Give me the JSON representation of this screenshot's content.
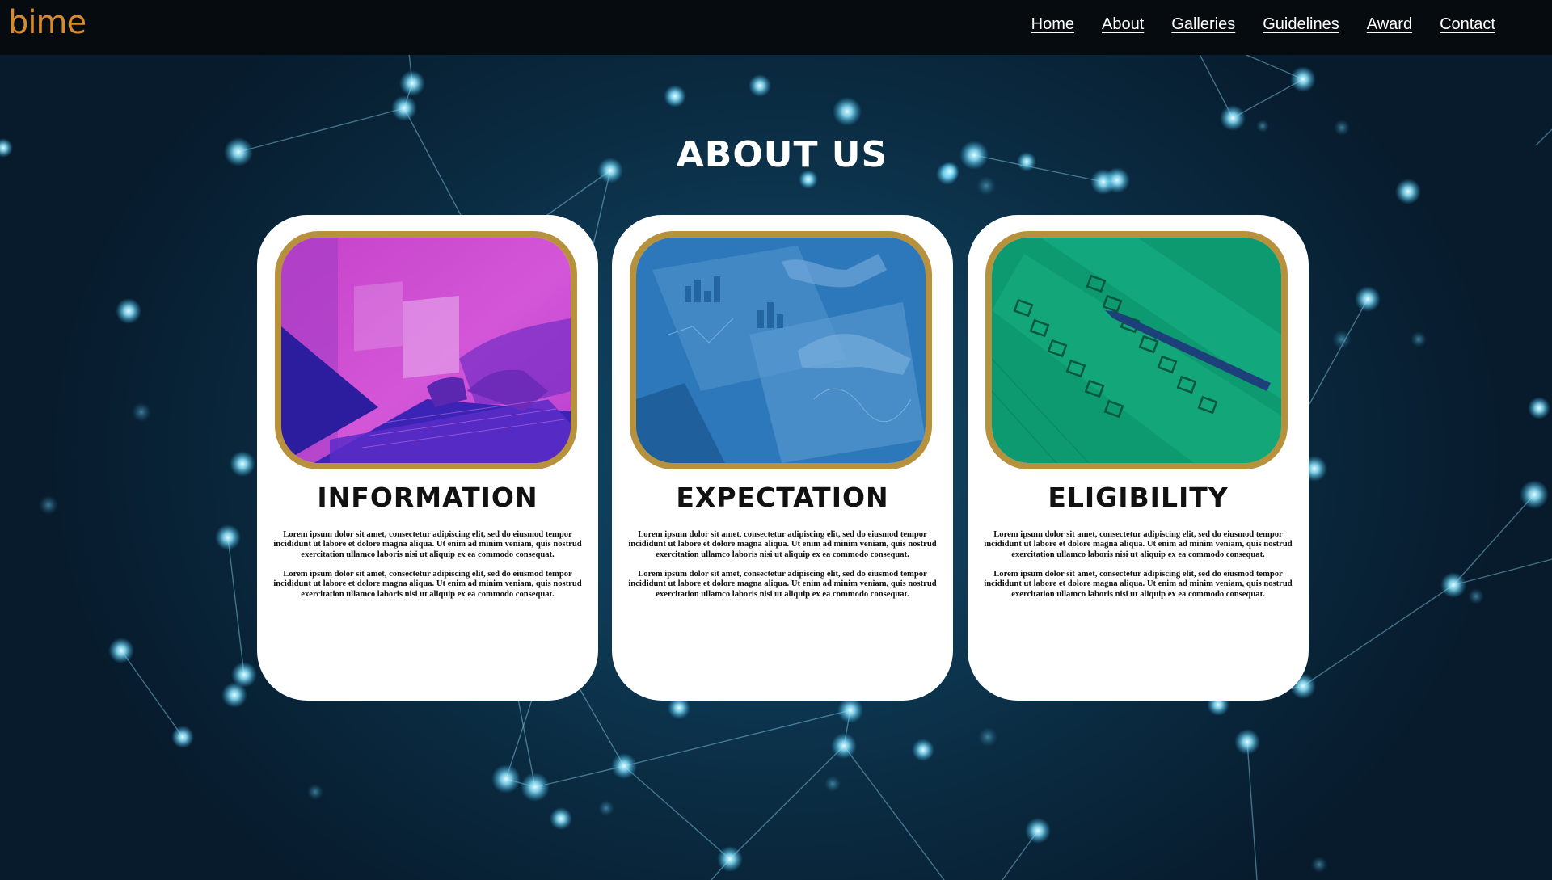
{
  "brand": {
    "logo_text": "bime",
    "logo_color": "#d68a2f"
  },
  "nav": {
    "items": [
      {
        "label": "Home"
      },
      {
        "label": "About"
      },
      {
        "label": "Galleries"
      },
      {
        "label": "Guidelines"
      },
      {
        "label": "Award"
      },
      {
        "label": "Contact"
      }
    ]
  },
  "main": {
    "heading": "ABOUT US",
    "cards": [
      {
        "title": "INFORMATION",
        "image_icon": "laptop-typing-photo",
        "image_tint": "#c43fd6",
        "paragraphs": [
          "Lorem ipsum dolor sit amet, consectetur adipiscing elit, sed do eiusmod tempor incididunt ut labore et dolore magna aliqua. Ut enim ad minim veniam, quis nostrud exercitation ullamco laboris nisi ut aliquip ex ea commodo consequat.",
          "Lorem ipsum dolor sit amet, consectetur adipiscing elit, sed do eiusmod tempor incididunt ut labore et dolore magna aliqua. Ut enim ad minim veniam, quis nostrud exercitation ullamco laboris nisi ut aliquip ex ea commodo consequat."
        ]
      },
      {
        "title": "EXPECTATION",
        "image_icon": "documents-charts-photo",
        "image_tint": "#2a74b8",
        "paragraphs": [
          "Lorem ipsum dolor sit amet, consectetur adipiscing elit, sed do eiusmod tempor incididunt ut labore et dolore magna aliqua. Ut enim ad minim veniam, quis nostrud exercitation ullamco laboris nisi ut aliquip ex ea commodo consequat.",
          "Lorem ipsum dolor sit amet, consectetur adipiscing elit, sed do eiusmod tempor incididunt ut labore et dolore magna aliqua. Ut enim ad minim veniam, quis nostrud exercitation ullamco laboris nisi ut aliquip ex ea commodo consequat."
        ]
      },
      {
        "title": "ELIGIBILITY",
        "image_icon": "checklist-pen-photo",
        "image_tint": "#0f9a72",
        "paragraphs": [
          "Lorem ipsum dolor sit amet, consectetur adipiscing elit, sed do eiusmod tempor incididunt ut labore et dolore magna aliqua. Ut enim ad minim veniam, quis nostrud exercitation ullamco laboris nisi ut aliquip ex ea commodo consequat.",
          "Lorem ipsum dolor sit amet, consectetur adipiscing elit, sed do eiusmod tempor incididunt ut labore et dolore magna aliqua. Ut enim ad minim veniam, quis nostrud exercitation ullamco laboris nisi ut aliquip ex ea commodo consequat."
        ]
      }
    ]
  },
  "colors": {
    "card_border": "#b8913c",
    "background_dark": "#0a2a40",
    "node_glow": "#8fe6ff"
  }
}
